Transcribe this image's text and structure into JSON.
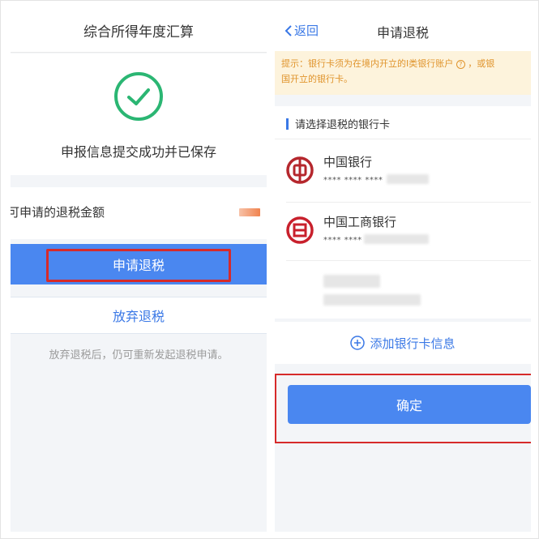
{
  "left": {
    "header_title": "综合所得年度汇算",
    "success_text": "申报信息提交成功并已保存",
    "amount_label": "可申请的退税金额",
    "apply_button": "申请退税",
    "abandon_button": "放弃退税",
    "note": "放弃退税后，仍可重新发起退税申请。"
  },
  "right": {
    "back_label": "返回",
    "title": "申请退税",
    "tip_line1": "提示：银行卡须为在境内开立的Ⅰ类银行账户",
    "tip_line2": "国开立的银行卡。",
    "tip_trail": "，或银",
    "cards_title": "请选择退税的银行卡",
    "banks": [
      {
        "name": "中国银行",
        "number": "**** **** ****"
      },
      {
        "name": "中国工商银行",
        "number": "**** ****"
      }
    ],
    "add_card": "添加银行卡信息",
    "confirm_button": "确定"
  },
  "colors": {
    "accent_blue": "#4a87f0",
    "highlight_red": "#d62a2a",
    "success_green": "#2bb673",
    "boc_red": "#b5272d",
    "icbc_red": "#c8202c"
  }
}
